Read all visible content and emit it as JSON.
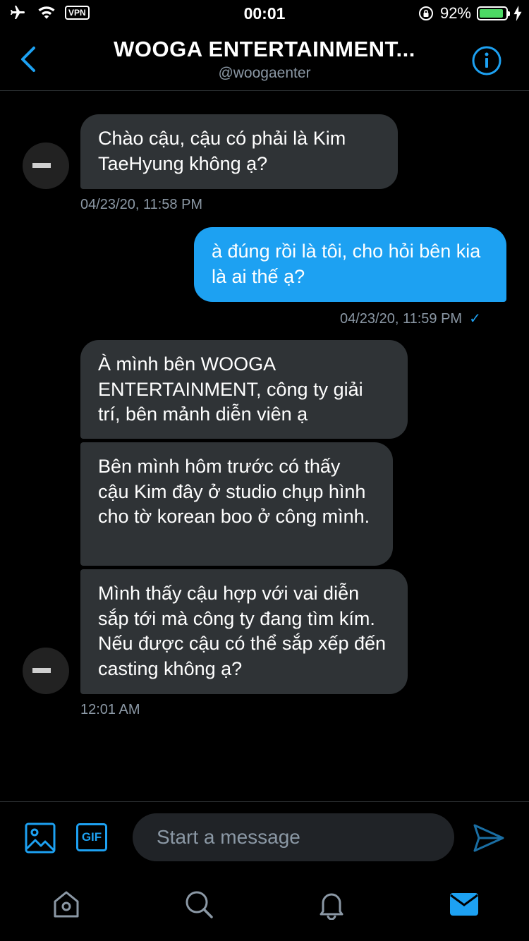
{
  "status_bar": {
    "time": "00:01",
    "vpn_label": "VPN",
    "battery_percent": "92%",
    "battery_level": 0.92
  },
  "header": {
    "title": "WOOGA ENTERTAINMENT...",
    "handle": "@woogaenter"
  },
  "messages": [
    {
      "direction": "incoming",
      "text": "Chào cậu, cậu có phải là Kim TaeHyung không ạ?",
      "timestamp": "04/23/20, 11:58 PM"
    },
    {
      "direction": "outgoing",
      "text": "à đúng rồi là tôi, cho hỏi bên kia là ai thế ạ?",
      "timestamp": "04/23/20, 11:59 PM",
      "read_mark": "✓"
    },
    {
      "direction": "incoming",
      "text": "À mình bên WOOGA ENTERTAINMENT, công ty giải trí, bên mảnh diễn viên ạ"
    },
    {
      "direction": "incoming",
      "text": "Bên mình hôm trước có thấy cậu Kim đây ở studio chụp hình cho tờ korean boo ở công mình."
    },
    {
      "direction": "incoming",
      "text": "Mình thấy cậu hợp với vai diễn sắp tới mà công ty đang tìm kím. Nếu được cậu có thể sắp xếp đến casting không ạ?",
      "timestamp": "12:01 AM"
    }
  ],
  "composer": {
    "gif_label": "GIF",
    "placeholder": "Start a message"
  },
  "tabs": [
    "home-icon",
    "search-icon",
    "notifications-icon",
    "messages-icon"
  ],
  "colors": {
    "accent": "#1da1f2",
    "incoming_bubble": "#2f3336",
    "background": "#000000"
  }
}
